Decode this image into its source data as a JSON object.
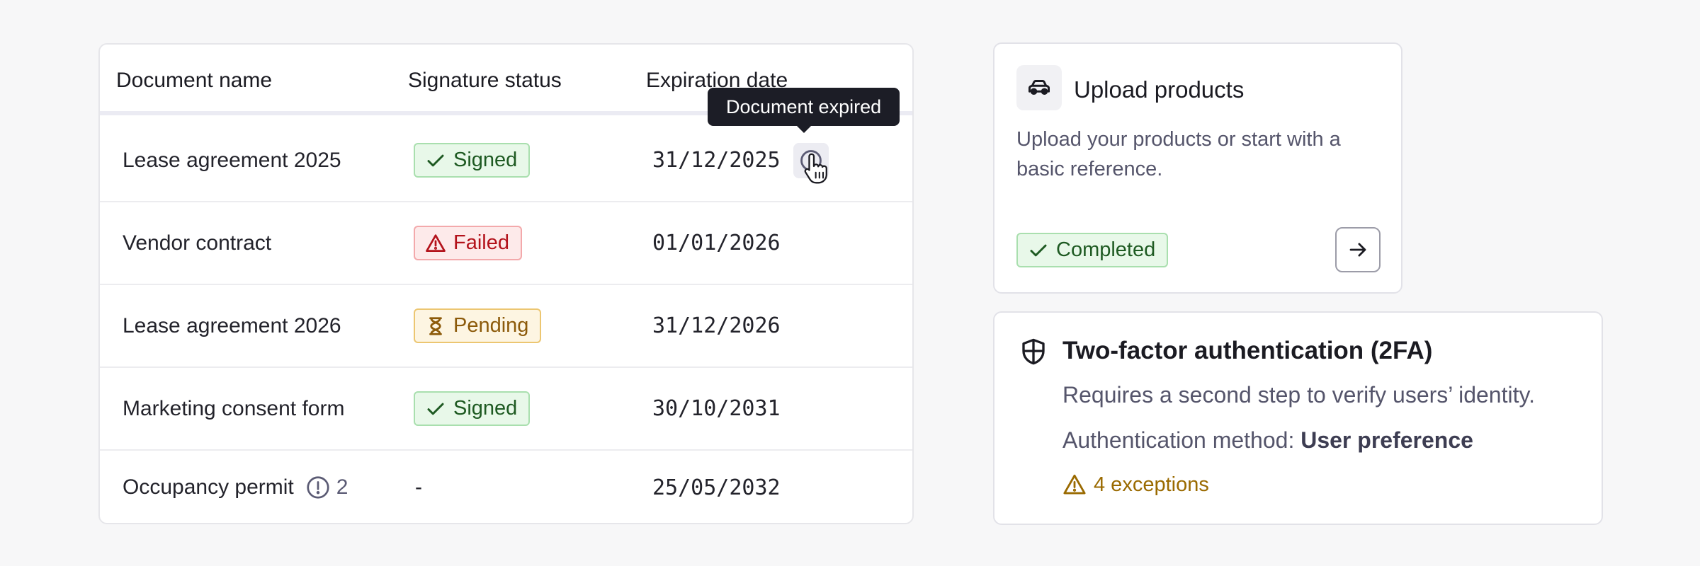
{
  "table": {
    "headers": {
      "name": "Document name",
      "status": "Signature status",
      "date": "Expiration date"
    },
    "rows": [
      {
        "name": "Lease agreement 2025",
        "status": "Signed",
        "status_type": "signed",
        "date": "31/12/2025",
        "alert": true
      },
      {
        "name": "Vendor contract",
        "status": "Failed",
        "status_type": "failed",
        "date": "01/01/2026",
        "alert": false
      },
      {
        "name": "Lease agreement 2026",
        "status": "Pending",
        "status_type": "pending",
        "date": "31/12/2026",
        "alert": false
      },
      {
        "name": "Marketing consent form",
        "status": "Signed",
        "status_type": "signed",
        "date": "30/10/2031",
        "alert": false
      },
      {
        "name": "Occupancy permit",
        "name_count": "2",
        "status": "-",
        "status_type": "none",
        "date": "25/05/2032",
        "alert": false
      }
    ],
    "tooltip": "Document expired"
  },
  "upload_card": {
    "icon": "car-icon",
    "title": "Upload products",
    "description": "Upload your products or start with a basic reference.",
    "status": "Completed",
    "action_icon": "arrow-right-icon"
  },
  "tfa_card": {
    "icon": "shield-icon",
    "title": "Two-factor authentication (2FA)",
    "description": "Requires a second step to verify users’ identity.",
    "method_label": "Authentication method:",
    "method_value": "User preference",
    "exceptions": "4 exceptions"
  },
  "colors": {
    "signed_bg": "#e8f8e9",
    "failed_bg": "#fdeaea",
    "pending_bg": "#fdf5e2",
    "warning": "#9a6a00",
    "tooltip_bg": "#1c1d26"
  }
}
